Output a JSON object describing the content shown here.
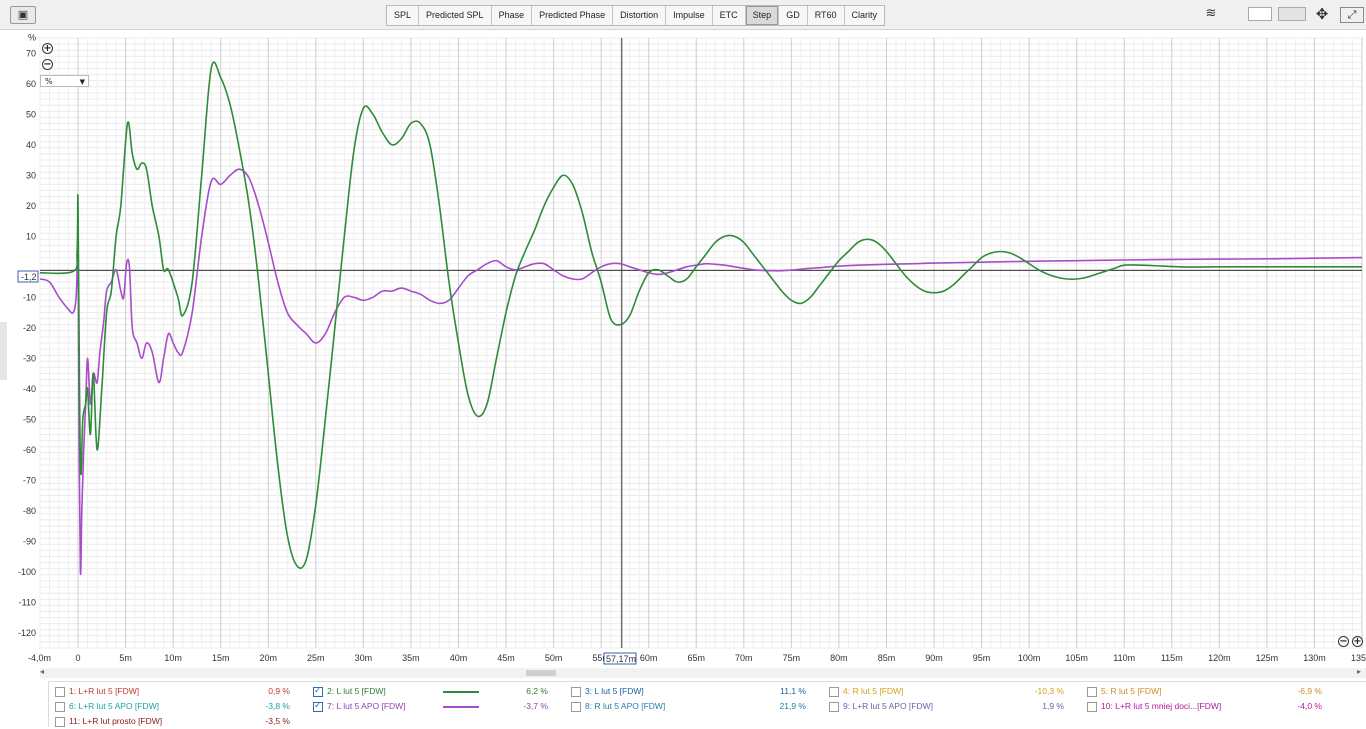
{
  "toolbar": {
    "tabs": [
      "SPL",
      "Predicted SPL",
      "Phase",
      "Predicted Phase",
      "Distortion",
      "Impulse",
      "ETC",
      "Step",
      "GD",
      "RT60",
      "Clarity"
    ],
    "active_tab": "Step"
  },
  "unit_select": {
    "value": "%"
  },
  "cursor": {
    "x_readout": "57,17m",
    "y_readout": "-1,2"
  },
  "chart_data": {
    "type": "line",
    "ylabel": "%",
    "xlim": [
      -4,
      135
    ],
    "ylim": [
      -125,
      75
    ],
    "x_ticks": [
      -4,
      0,
      5,
      10,
      15,
      20,
      25,
      30,
      35,
      40,
      45,
      50,
      55,
      60,
      65,
      70,
      75,
      80,
      85,
      90,
      95,
      100,
      105,
      110,
      115,
      120,
      125,
      130,
      135
    ],
    "x_tick_labels": [
      "-4,0m",
      "0",
      "5m",
      "10m",
      "15m",
      "20m",
      "25m",
      "30m",
      "35m",
      "40m",
      "45m",
      "50m",
      "55m",
      "60m",
      "65m",
      "70m",
      "75m",
      "80m",
      "85m",
      "90m",
      "95m",
      "100m",
      "105m",
      "110m",
      "115m",
      "120m",
      "125m",
      "130m",
      "135"
    ],
    "y_ticks": [
      70,
      60,
      50,
      40,
      30,
      20,
      10,
      -10,
      -20,
      -30,
      -40,
      -50,
      -60,
      -70,
      -80,
      -90,
      -100,
      -110,
      -120
    ],
    "grid": true,
    "cursor_x": 57.17,
    "cursor_y": -1.2,
    "series": [
      {
        "name": "2: L lut 5 [FDW]",
        "color": "#2e8b3a",
        "points": [
          [
            -4,
            -2
          ],
          [
            -0.5,
            -1.5
          ],
          [
            -0.1,
            5
          ],
          [
            0,
            22
          ],
          [
            0.15,
            -40
          ],
          [
            0.3,
            -68
          ],
          [
            0.5,
            -50
          ],
          [
            0.8,
            -45
          ],
          [
            1,
            -40
          ],
          [
            1.3,
            -55
          ],
          [
            1.6,
            -35
          ],
          [
            2,
            -60
          ],
          [
            2.5,
            -40
          ],
          [
            3,
            -15
          ],
          [
            3.5,
            -8
          ],
          [
            4,
            10
          ],
          [
            4.5,
            20
          ],
          [
            5.2,
            47
          ],
          [
            5.7,
            37
          ],
          [
            6.2,
            32
          ],
          [
            6.7,
            34
          ],
          [
            7.2,
            32
          ],
          [
            7.8,
            20
          ],
          [
            8.5,
            10
          ],
          [
            9,
            -1
          ],
          [
            9.5,
            -1
          ],
          [
            10.5,
            -10
          ],
          [
            11,
            -16
          ],
          [
            12,
            -5
          ],
          [
            13,
            30
          ],
          [
            14,
            65
          ],
          [
            15,
            62
          ],
          [
            16,
            53
          ],
          [
            17,
            38
          ],
          [
            18,
            20
          ],
          [
            19,
            -5
          ],
          [
            20,
            -35
          ],
          [
            21,
            -65
          ],
          [
            22,
            -88
          ],
          [
            23,
            -98
          ],
          [
            24,
            -96
          ],
          [
            25,
            -78
          ],
          [
            26,
            -50
          ],
          [
            27,
            -20
          ],
          [
            28,
            10
          ],
          [
            29,
            38
          ],
          [
            30,
            52
          ],
          [
            31,
            50
          ],
          [
            32,
            44
          ],
          [
            33,
            40
          ],
          [
            34,
            42
          ],
          [
            35,
            47
          ],
          [
            36,
            47
          ],
          [
            37,
            40
          ],
          [
            38,
            20
          ],
          [
            39,
            -5
          ],
          [
            40,
            -25
          ],
          [
            41,
            -42
          ],
          [
            42,
            -49
          ],
          [
            43,
            -45
          ],
          [
            44,
            -30
          ],
          [
            45,
            -15
          ],
          [
            46,
            -3
          ],
          [
            47,
            5
          ],
          [
            48,
            12
          ],
          [
            49,
            20
          ],
          [
            50,
            26
          ],
          [
            51,
            30
          ],
          [
            52,
            27
          ],
          [
            53,
            18
          ],
          [
            54,
            5
          ],
          [
            55,
            -5
          ],
          [
            56,
            -17
          ],
          [
            57,
            -19
          ],
          [
            58,
            -16
          ],
          [
            59,
            -8
          ],
          [
            60,
            -2
          ],
          [
            61,
            -1
          ],
          [
            62,
            -3
          ],
          [
            63,
            -5
          ],
          [
            64,
            -4
          ],
          [
            65,
            0
          ],
          [
            66,
            4
          ],
          [
            67,
            8
          ],
          [
            68,
            10
          ],
          [
            69,
            10
          ],
          [
            70,
            8
          ],
          [
            71,
            4
          ],
          [
            72,
            0
          ],
          [
            73,
            -4
          ],
          [
            74,
            -8
          ],
          [
            75,
            -11
          ],
          [
            76,
            -12
          ],
          [
            77,
            -10
          ],
          [
            78,
            -6
          ],
          [
            79,
            -2
          ],
          [
            80,
            2
          ],
          [
            81,
            5
          ],
          [
            82,
            8
          ],
          [
            83,
            9
          ],
          [
            84,
            8
          ],
          [
            85,
            5
          ],
          [
            86,
            1
          ],
          [
            87,
            -3
          ],
          [
            88,
            -6
          ],
          [
            89,
            -8
          ],
          [
            90,
            -8.5
          ],
          [
            91,
            -8
          ],
          [
            92,
            -6
          ],
          [
            93,
            -3
          ],
          [
            94,
            0
          ],
          [
            95,
            3
          ],
          [
            96,
            4.5
          ],
          [
            97,
            5
          ],
          [
            98,
            4.5
          ],
          [
            99,
            3
          ],
          [
            100,
            1
          ],
          [
            101,
            -1
          ],
          [
            102,
            -2.5
          ],
          [
            103,
            -3.5
          ],
          [
            104,
            -4
          ],
          [
            105,
            -4
          ],
          [
            106,
            -3.5
          ],
          [
            107,
            -2.5
          ],
          [
            108,
            -1.5
          ],
          [
            109,
            -0.5
          ],
          [
            110,
            0.5
          ],
          [
            112,
            0.5
          ],
          [
            114,
            0.2
          ],
          [
            117,
            -0.1
          ],
          [
            120,
            0
          ],
          [
            125,
            0
          ],
          [
            130,
            0
          ],
          [
            135,
            0
          ]
        ]
      },
      {
        "name": "7: L lut 5 APO [FDW]",
        "color": "#a64dc9",
        "points": [
          [
            -4,
            -4
          ],
          [
            -3,
            -5
          ],
          [
            -2,
            -10
          ],
          [
            -1,
            -14
          ],
          [
            -0.5,
            -15
          ],
          [
            -0.2,
            -10
          ],
          [
            -0.05,
            5
          ],
          [
            0,
            12
          ],
          [
            0.1,
            -50
          ],
          [
            0.25,
            -100
          ],
          [
            0.4,
            -80
          ],
          [
            0.6,
            -60
          ],
          [
            0.8,
            -45
          ],
          [
            1,
            -30
          ],
          [
            1.3,
            -45
          ],
          [
            1.6,
            -35
          ],
          [
            2,
            -38
          ],
          [
            2.3,
            -28
          ],
          [
            2.7,
            -18
          ],
          [
            3,
            -8
          ],
          [
            3.5,
            -5
          ],
          [
            4,
            -1
          ],
          [
            4.5,
            -8
          ],
          [
            4.8,
            -10
          ],
          [
            5.1,
            1
          ],
          [
            5.4,
            0
          ],
          [
            5.7,
            -20
          ],
          [
            6.2,
            -25
          ],
          [
            6.7,
            -30
          ],
          [
            7.2,
            -25
          ],
          [
            7.8,
            -28
          ],
          [
            8.5,
            -38
          ],
          [
            9,
            -30
          ],
          [
            9.5,
            -22
          ],
          [
            10,
            -25
          ],
          [
            10.5,
            -28
          ],
          [
            11,
            -28
          ],
          [
            12,
            -15
          ],
          [
            13,
            10
          ],
          [
            14,
            28
          ],
          [
            15,
            27
          ],
          [
            16,
            30
          ],
          [
            17,
            32
          ],
          [
            18,
            29
          ],
          [
            19,
            20
          ],
          [
            20,
            8
          ],
          [
            21,
            -5
          ],
          [
            22,
            -15
          ],
          [
            23,
            -19
          ],
          [
            24,
            -22
          ],
          [
            25,
            -25
          ],
          [
            26,
            -22
          ],
          [
            27,
            -15
          ],
          [
            28,
            -10
          ],
          [
            29,
            -10
          ],
          [
            30,
            -11
          ],
          [
            31,
            -10
          ],
          [
            32,
            -8
          ],
          [
            33,
            -8
          ],
          [
            34,
            -7
          ],
          [
            35,
            -8
          ],
          [
            36,
            -9
          ],
          [
            37,
            -11
          ],
          [
            38,
            -12
          ],
          [
            39,
            -11
          ],
          [
            40,
            -7
          ],
          [
            41,
            -3
          ],
          [
            42,
            -1
          ],
          [
            43,
            1
          ],
          [
            44,
            2
          ],
          [
            45,
            0
          ],
          [
            46,
            -1
          ],
          [
            47,
            0
          ],
          [
            48,
            1
          ],
          [
            49,
            1
          ],
          [
            50,
            -1
          ],
          [
            51,
            -3
          ],
          [
            52,
            -4
          ],
          [
            53,
            -4
          ],
          [
            54,
            -2
          ],
          [
            55,
            0
          ],
          [
            56,
            1
          ],
          [
            57,
            1
          ],
          [
            58,
            0
          ],
          [
            59,
            -1
          ],
          [
            60,
            -2
          ],
          [
            61,
            -2.5
          ],
          [
            62,
            -2
          ],
          [
            63,
            -1
          ],
          [
            64,
            0
          ],
          [
            65,
            0.5
          ],
          [
            66,
            1
          ],
          [
            67,
            0.8
          ],
          [
            68,
            0.5
          ],
          [
            69,
            0
          ],
          [
            70,
            -0.5
          ],
          [
            71,
            -1
          ],
          [
            72,
            -1.2
          ],
          [
            73,
            -1.3
          ],
          [
            74,
            -1.3
          ],
          [
            75,
            -1.1
          ],
          [
            76,
            -0.8
          ],
          [
            77,
            -0.5
          ],
          [
            78,
            -0.3
          ],
          [
            79,
            0
          ],
          [
            80,
            0.2
          ],
          [
            82,
            0.5
          ],
          [
            85,
            0.8
          ],
          [
            88,
            1
          ],
          [
            90,
            1.2
          ],
          [
            95,
            1.5
          ],
          [
            100,
            1.8
          ],
          [
            105,
            2
          ],
          [
            110,
            2.2
          ],
          [
            115,
            2.4
          ],
          [
            120,
            2.5
          ],
          [
            125,
            2.6
          ],
          [
            130,
            2.8
          ],
          [
            135,
            3
          ]
        ]
      }
    ]
  },
  "legend": {
    "rows": [
      [
        {
          "label": "1: L+R lut 5 [FDW]",
          "value": "0,9 %",
          "color": "#c0392b",
          "checked": false
        },
        {
          "label": "2: L lut 5 [FDW]",
          "value": "6,2 %",
          "color": "#2e7d32",
          "checked": true,
          "swatch": "#2e8b3a"
        },
        {
          "label": "3: L lut 5 [FDW]",
          "value": "11,1 %",
          "color": "#1f5fa8",
          "checked": false
        },
        {
          "label": "4: R lut 5 [FDW]",
          "value": "-10,3 %",
          "color": "#d4a017",
          "checked": false
        },
        {
          "label": "5: R lut 5 [FDW]",
          "value": "-6,9 %",
          "color": "#d18a2a",
          "checked": false
        }
      ],
      [
        {
          "label": "6: L+R lut 5 APO [FDW]",
          "value": "-3,8 %",
          "color": "#1aa3a3",
          "checked": false
        },
        {
          "label": "7: L lut 5 APO [FDW]",
          "value": "-3,7 %",
          "color": "#8e44ad",
          "checked": true,
          "swatch": "#a64dc9"
        },
        {
          "label": "8: R lut 5 APO [FDW]",
          "value": "21,9 %",
          "color": "#1f7fa8",
          "checked": false
        },
        {
          "label": "9: L+R lut 5 APO [FDW]",
          "value": "1,9 %",
          "color": "#6b5fa8",
          "checked": false
        },
        {
          "label": "10: L+R lut 5 mniej doci...[FDW]",
          "value": "-4,0 %",
          "color": "#b5179e",
          "checked": false
        }
      ],
      [
        {
          "label": "11: L+R lut  prosto [FDW]",
          "value": "-3,5 %",
          "color": "#8b1a1a",
          "checked": false
        }
      ]
    ]
  }
}
